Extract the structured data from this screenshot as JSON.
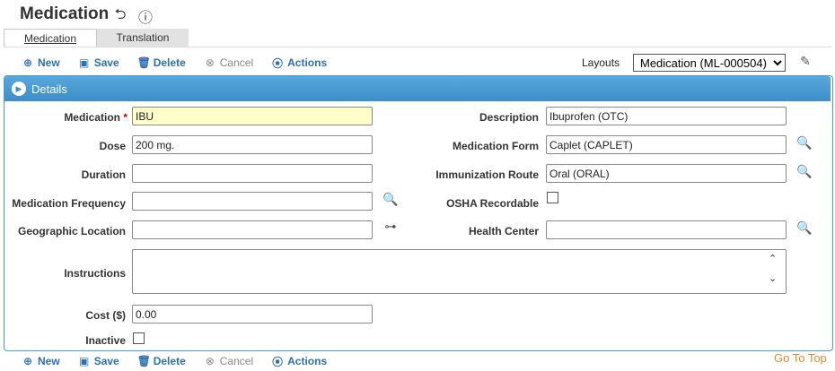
{
  "page": {
    "title": "Medication",
    "tabs": [
      {
        "label": "Medication",
        "active": true
      },
      {
        "label": "Translation",
        "active": false
      }
    ]
  },
  "toolbar": {
    "new": "New",
    "save": "Save",
    "delete": "Delete",
    "cancel": "Cancel",
    "actions": "Actions"
  },
  "layouts": {
    "label": "Layouts",
    "selected": "Medication (ML-000504)"
  },
  "panel": {
    "title": "Details"
  },
  "form": {
    "medication": {
      "label": "Medication",
      "required": "*",
      "value": "IBU"
    },
    "dose": {
      "label": "Dose",
      "value": "200 mg."
    },
    "duration": {
      "label": "Duration",
      "value": ""
    },
    "frequency": {
      "label": "Medication Frequency",
      "value": ""
    },
    "geo_location": {
      "label": "Geographic Location",
      "value": ""
    },
    "description": {
      "label": "Description",
      "value": "Ibuprofen (OTC)"
    },
    "med_form": {
      "label": "Medication Form",
      "value": "Caplet (CAPLET)"
    },
    "immunization_route": {
      "label": "Immunization Route",
      "value": "Oral (ORAL)"
    },
    "osha": {
      "label": "OSHA Recordable",
      "checked": false
    },
    "health_center": {
      "label": "Health Center",
      "value": ""
    },
    "instructions": {
      "label": "Instructions",
      "value": ""
    },
    "cost": {
      "label": "Cost ($)",
      "value": "0.00"
    },
    "inactive": {
      "label": "Inactive",
      "checked": false
    }
  },
  "footer": {
    "go_to_top": "Go To Top"
  },
  "colors": {
    "accent": "#3d8ec9",
    "link": "#2c6fb4",
    "required_field": "#fffdc8",
    "go_to_top": "#e08a2a"
  }
}
